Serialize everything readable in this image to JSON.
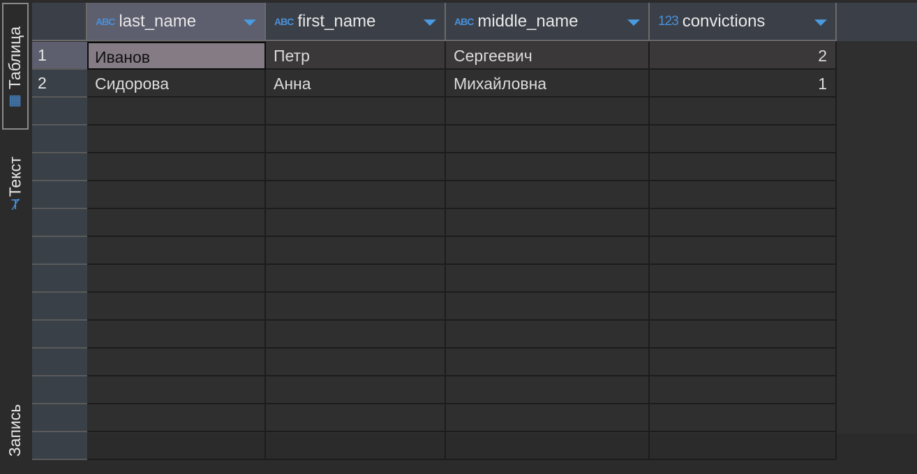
{
  "side_tabs": [
    {
      "label": "Таблица",
      "icon": "table-icon",
      "active": true
    },
    {
      "label": "Текст",
      "icon": "text-icon",
      "active": false
    },
    {
      "label": "Запись",
      "icon": "record-icon",
      "active": false
    }
  ],
  "columns": [
    {
      "name": "last_name",
      "type_badge": "ABC"
    },
    {
      "name": "first_name",
      "type_badge": "ABC"
    },
    {
      "name": "middle_name",
      "type_badge": "ABC"
    },
    {
      "name": "convictions",
      "type_badge": "123"
    }
  ],
  "rows": [
    {
      "num": "1",
      "cells": [
        "Иванов",
        "Петр",
        "Сергеевич",
        "2"
      ]
    },
    {
      "num": "2",
      "cells": [
        "Сидорова",
        "Анна",
        "Михайловна",
        "1"
      ]
    }
  ],
  "colors": {
    "accent": "#4a90d9",
    "selected_cell": "#857b85",
    "header_selected": "#5d5e6e"
  }
}
